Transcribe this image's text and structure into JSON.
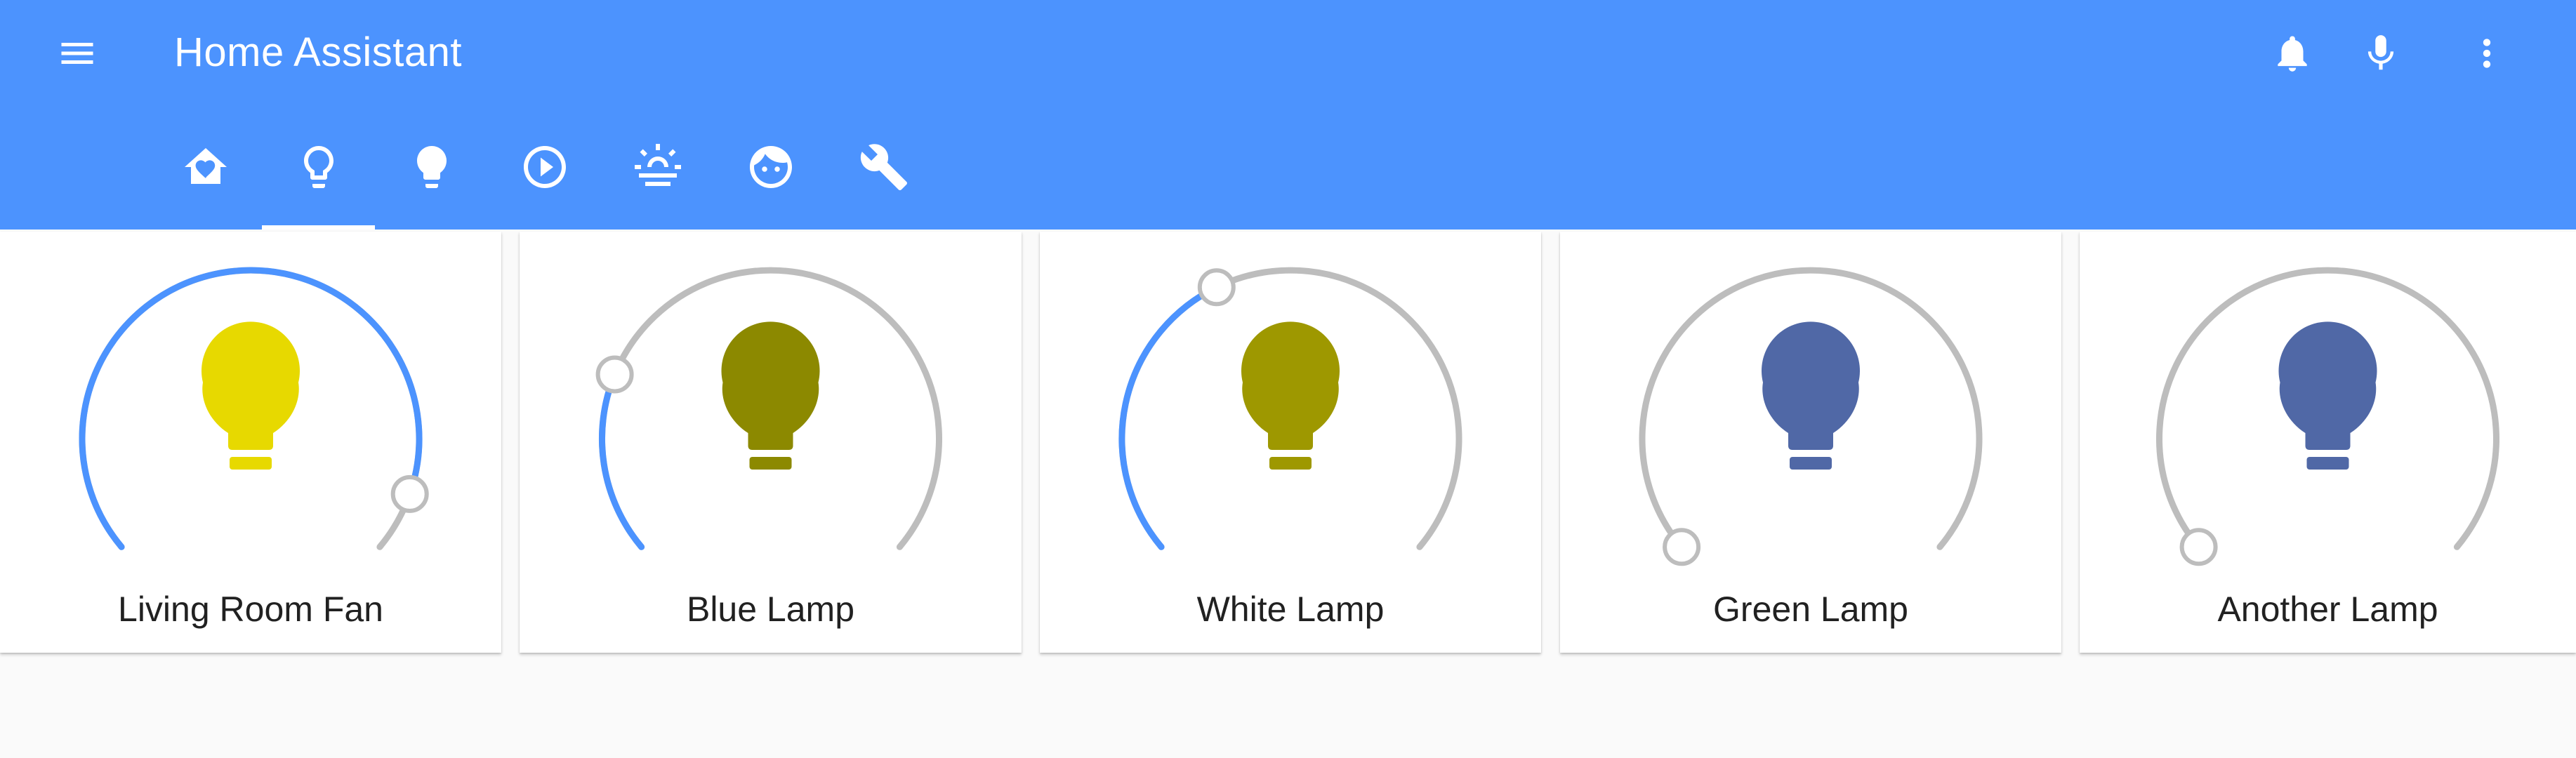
{
  "app": {
    "title": "Home Assistant"
  },
  "header_actions": [
    "menu-icon",
    "bell-icon",
    "microphone-icon",
    "more-vertical-icon"
  ],
  "tabs": [
    {
      "icon": "home-heart-icon",
      "active": false
    },
    {
      "icon": "lightbulb-outline-icon",
      "active": true
    },
    {
      "icon": "lightbulb-icon",
      "active": false
    },
    {
      "icon": "play-circle-icon",
      "active": false
    },
    {
      "icon": "weather-sunset-icon",
      "active": false
    },
    {
      "icon": "face-icon",
      "active": false
    },
    {
      "icon": "wrench-icon",
      "active": false
    }
  ],
  "colors": {
    "header": "#4c93fe",
    "slider_active": "#4c93fe",
    "slider_track": "#bdbdbd"
  },
  "lights": [
    {
      "name": "Living Room Fan",
      "brightness_fraction": 0.92,
      "bulb_color": "#e7d900"
    },
    {
      "name": "Blue Lamp",
      "brightness_fraction": 0.24,
      "bulb_color": "#8c8900"
    },
    {
      "name": "White Lamp",
      "brightness_fraction": 0.4,
      "bulb_color": "#9e9800"
    },
    {
      "name": "Green Lamp",
      "brightness_fraction": 0.0,
      "bulb_color": "#5068a6"
    },
    {
      "name": "Another Lamp",
      "brightness_fraction": 0.0,
      "bulb_color": "#5068a6"
    }
  ]
}
